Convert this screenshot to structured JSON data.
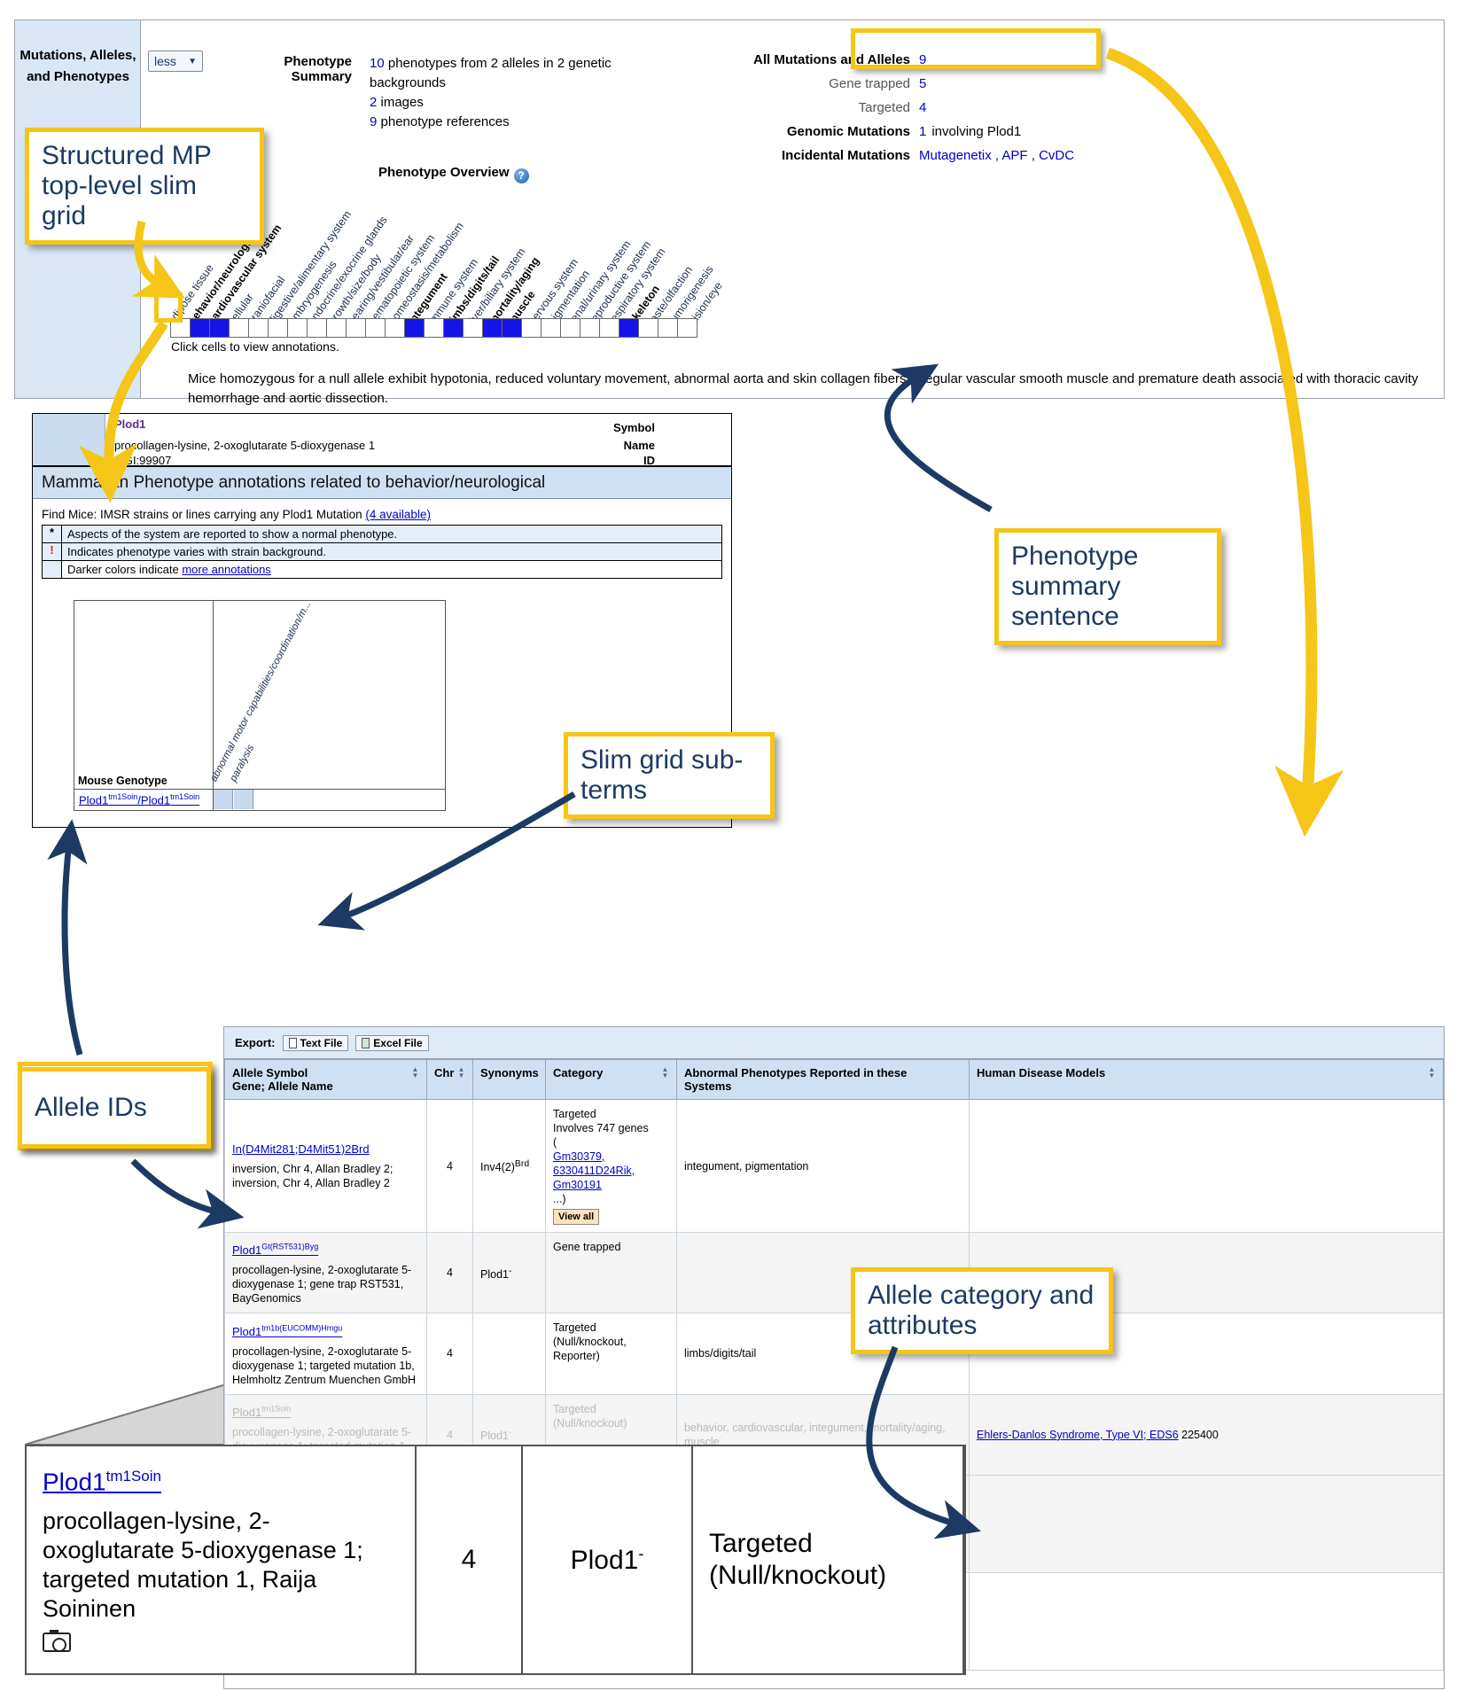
{
  "panel_top": {
    "section_label": "Mutations, Alleles, and Phenotypes",
    "toggle_label": "less",
    "toggle_caret": "▼",
    "phenotype_summary_label": "Phenotype Summary",
    "summary_lines": [
      {
        "count": "10",
        "text": "phenotypes from 2 alleles in 2 genetic backgrounds"
      },
      {
        "count": "2",
        "text": "images"
      },
      {
        "count": "9",
        "text": "phenotype references"
      }
    ],
    "mutations": [
      {
        "key": "All Mutations and Alleles",
        "value": "9",
        "style": "bold"
      },
      {
        "key": "Gene trapped",
        "value": "5",
        "style": "grey"
      },
      {
        "key": "Targeted",
        "value": "4",
        "style": "grey"
      },
      {
        "key": "Genomic Mutations",
        "value": "1",
        "suffix": "involving Plod1",
        "style": "bold"
      },
      {
        "key": "Incidental Mutations",
        "value": "Mutagenetix , APF , CvDC",
        "style": "bold"
      }
    ],
    "phenotype_overview_title": "Phenotype Overview",
    "help_icon_glyph": "?",
    "click_cells_note": "Click cells to view annotations.",
    "summary_sentence": "Mice homozygous for a null allele exhibit hypotonia, reduced voluntary movement, abnormal aorta and skin collagen fibers, irregular vascular smooth muscle and premature death associated with thoracic cavity hemorrhage and aortic dissection."
  },
  "slim_grid": {
    "systems": [
      {
        "label": "adipose tissue",
        "bold": false,
        "on": false
      },
      {
        "label": "behavior/neurological",
        "bold": true,
        "on": true
      },
      {
        "label": "cardiovascular system",
        "bold": true,
        "on": true
      },
      {
        "label": "cellular",
        "bold": false,
        "on": false
      },
      {
        "label": "craniofacial",
        "bold": false,
        "on": false
      },
      {
        "label": "digestive/alimentary system",
        "bold": false,
        "on": false
      },
      {
        "label": "embryogenesis",
        "bold": false,
        "on": false
      },
      {
        "label": "endocrine/exocrine glands",
        "bold": false,
        "on": false
      },
      {
        "label": "growth/size/body",
        "bold": false,
        "on": false
      },
      {
        "label": "hearing/vestibular/ear",
        "bold": false,
        "on": false
      },
      {
        "label": "hematopoietic system",
        "bold": false,
        "on": false
      },
      {
        "label": "homeostasis/metabolism",
        "bold": false,
        "on": false
      },
      {
        "label": "integument",
        "bold": true,
        "on": true
      },
      {
        "label": "immune system",
        "bold": false,
        "on": false
      },
      {
        "label": "limbs/digits/tail",
        "bold": true,
        "on": true
      },
      {
        "label": "liver/biliary system",
        "bold": false,
        "on": false
      },
      {
        "label": "mortality/aging",
        "bold": true,
        "on": true
      },
      {
        "label": "muscle",
        "bold": true,
        "on": true
      },
      {
        "label": "nervous system",
        "bold": false,
        "on": false
      },
      {
        "label": "pigmentation",
        "bold": false,
        "on": false
      },
      {
        "label": "renal/urinary system",
        "bold": false,
        "on": false
      },
      {
        "label": "reproductive system",
        "bold": false,
        "on": false
      },
      {
        "label": "respiratory system",
        "bold": false,
        "on": false
      },
      {
        "label": "skeleton",
        "bold": true,
        "on": true
      },
      {
        "label": "taste/olfaction",
        "bold": false,
        "on": false
      },
      {
        "label": "tumorigenesis",
        "bold": false,
        "on": false
      },
      {
        "label": "vision/eye",
        "bold": false,
        "on": false
      }
    ]
  },
  "gene_panel": {
    "rows": [
      {
        "key": "Symbol",
        "value": "Plod1"
      },
      {
        "key": "Name",
        "value": "procollagen-lysine, 2-oxoglutarate 5-dioxygenase 1"
      },
      {
        "key": "ID",
        "value": "MGI:99907"
      }
    ],
    "banner": "Mammalian Phenotype annotations related to behavior/neurological",
    "find_mice_text": "Find Mice: IMSR strains or lines carrying any Plod1 Mutation",
    "find_mice_link": "(4 available)",
    "legend": [
      {
        "symbol": "*",
        "text": "Aspects of the system are reported to show a normal phenotype."
      },
      {
        "symbol": "!",
        "text": "Indicates phenotype varies with strain background."
      },
      {
        "symbol": "",
        "text": "Darker colors indicate",
        "link": "more annotations"
      }
    ],
    "grid": {
      "mouse_genotype_label": "Mouse Genotype",
      "subterms": [
        "abnormal motor capabilities/coordination/m...",
        "paralysis"
      ],
      "genotype": {
        "prefix": "Plod1",
        "sup1": "tm1Soin",
        "mid": "/Plod1",
        "sup2": "tm1Soin"
      }
    }
  },
  "allele_table": {
    "export_label": "Export:",
    "export_buttons": [
      "Text File",
      "Excel File"
    ],
    "headers": [
      {
        "line1": "Allele Symbol",
        "line2": "Gene; Allele Name",
        "sortable": true
      },
      {
        "line1": "Chr",
        "line2": "",
        "sortable": true
      },
      {
        "line1": "Synonyms",
        "line2": "",
        "sortable": false
      },
      {
        "line1": "Category",
        "line2": "",
        "sortable": true
      },
      {
        "line1": "Abnormal Phenotypes Reported in these",
        "line2": "Systems",
        "sortable": false
      },
      {
        "line1": "Human Disease Models",
        "line2": "",
        "sortable": true
      }
    ],
    "rows": [
      {
        "symbol": "In(D4Mit281;D4Mit51)2Brd",
        "sup": "",
        "name": "inversion, Chr 4, Allan Bradley 2; inversion, Chr 4, Allan Bradley 2",
        "chr": "4",
        "synonym": "Inv4(2)",
        "synonym_sup": "Brd",
        "category_lines": [
          "Targeted",
          "Involves 747 genes"
        ],
        "category_genes": [
          "Gm30379,",
          "6330411D24Rik,",
          "Gm30191"
        ],
        "category_view_all": "View all",
        "phenotypes": "integument, pigmentation",
        "disease": "",
        "alt": false,
        "faded": false
      },
      {
        "symbol": "Plod1",
        "sup": "Gt(RST531)Byg",
        "name": "procollagen-lysine, 2-oxoglutarate 5-dioxygenase 1; gene trap RST531, BayGenomics",
        "chr": "4",
        "synonym": "Plod1",
        "synonym_sup": "-",
        "category_lines": [
          "Gene trapped"
        ],
        "category_genes": [],
        "category_view_all": "",
        "phenotypes": "",
        "disease": "",
        "alt": true,
        "faded": false
      },
      {
        "symbol": "Plod1",
        "sup": "tm1b(EUCOMM)Hmgu",
        "name": "procollagen-lysine, 2-oxoglutarate 5-dioxygenase 1; targeted mutation 1b, Helmholtz Zentrum Muenchen GmbH",
        "chr": "4",
        "synonym": "",
        "synonym_sup": "",
        "category_lines": [
          "Targeted",
          "(Null/knockout,",
          "Reporter)"
        ],
        "category_genes": [],
        "category_view_all": "",
        "phenotypes": "limbs/digits/tail",
        "disease": "",
        "alt": false,
        "faded": false
      },
      {
        "symbol": "Plod1",
        "sup": "tm1Soin",
        "name": "procollagen-lysine, 2-oxoglutarate 5-dioxygenase 1; targeted mutation 1, Raija Soininen",
        "chr": "4",
        "synonym": "Plod1",
        "synonym_sup": "-",
        "category_lines": [
          "Targeted",
          "(Null/knockout)"
        ],
        "category_genes": [],
        "category_view_all": "",
        "phenotypes": "behavior, cardiovascular, integument, mortality/aging, muscle",
        "disease": "Ehlers-Danlos Syndrome, Type VI; EDS6",
        "disease_suffix": " 225400",
        "alt": true,
        "faded": true
      }
    ]
  },
  "magnifier": {
    "symbol": "Plod1",
    "sup": "tm1Soin",
    "name": "procollagen-lysine, 2-oxoglutarate 5-dioxygenase 1; targeted mutation 1, Raija Soininen",
    "camera_icon": "camera-icon",
    "chr": "4",
    "synonym": "Plod1",
    "synonym_sup": "-",
    "category": "Targeted (Null/knockout)"
  },
  "callouts": [
    {
      "id": "callout-slim-grid",
      "text": "Structured MP top-level slim grid"
    },
    {
      "id": "callout-phenotype-summary",
      "text": "Phenotype summary sentence"
    },
    {
      "id": "callout-slim-subterms",
      "text": "Slim grid sub-terms"
    },
    {
      "id": "callout-allele-ids",
      "text": "Allele IDs"
    },
    {
      "id": "callout-allele-category",
      "text": "Allele category and attributes"
    }
  ],
  "colors": {
    "highlight": "#f5c518",
    "arrow_dark": "#1c3a63",
    "arrow_yellow": "#f5c518",
    "grid_on": "#1414e6",
    "panel_header": "#cfe0f2"
  }
}
